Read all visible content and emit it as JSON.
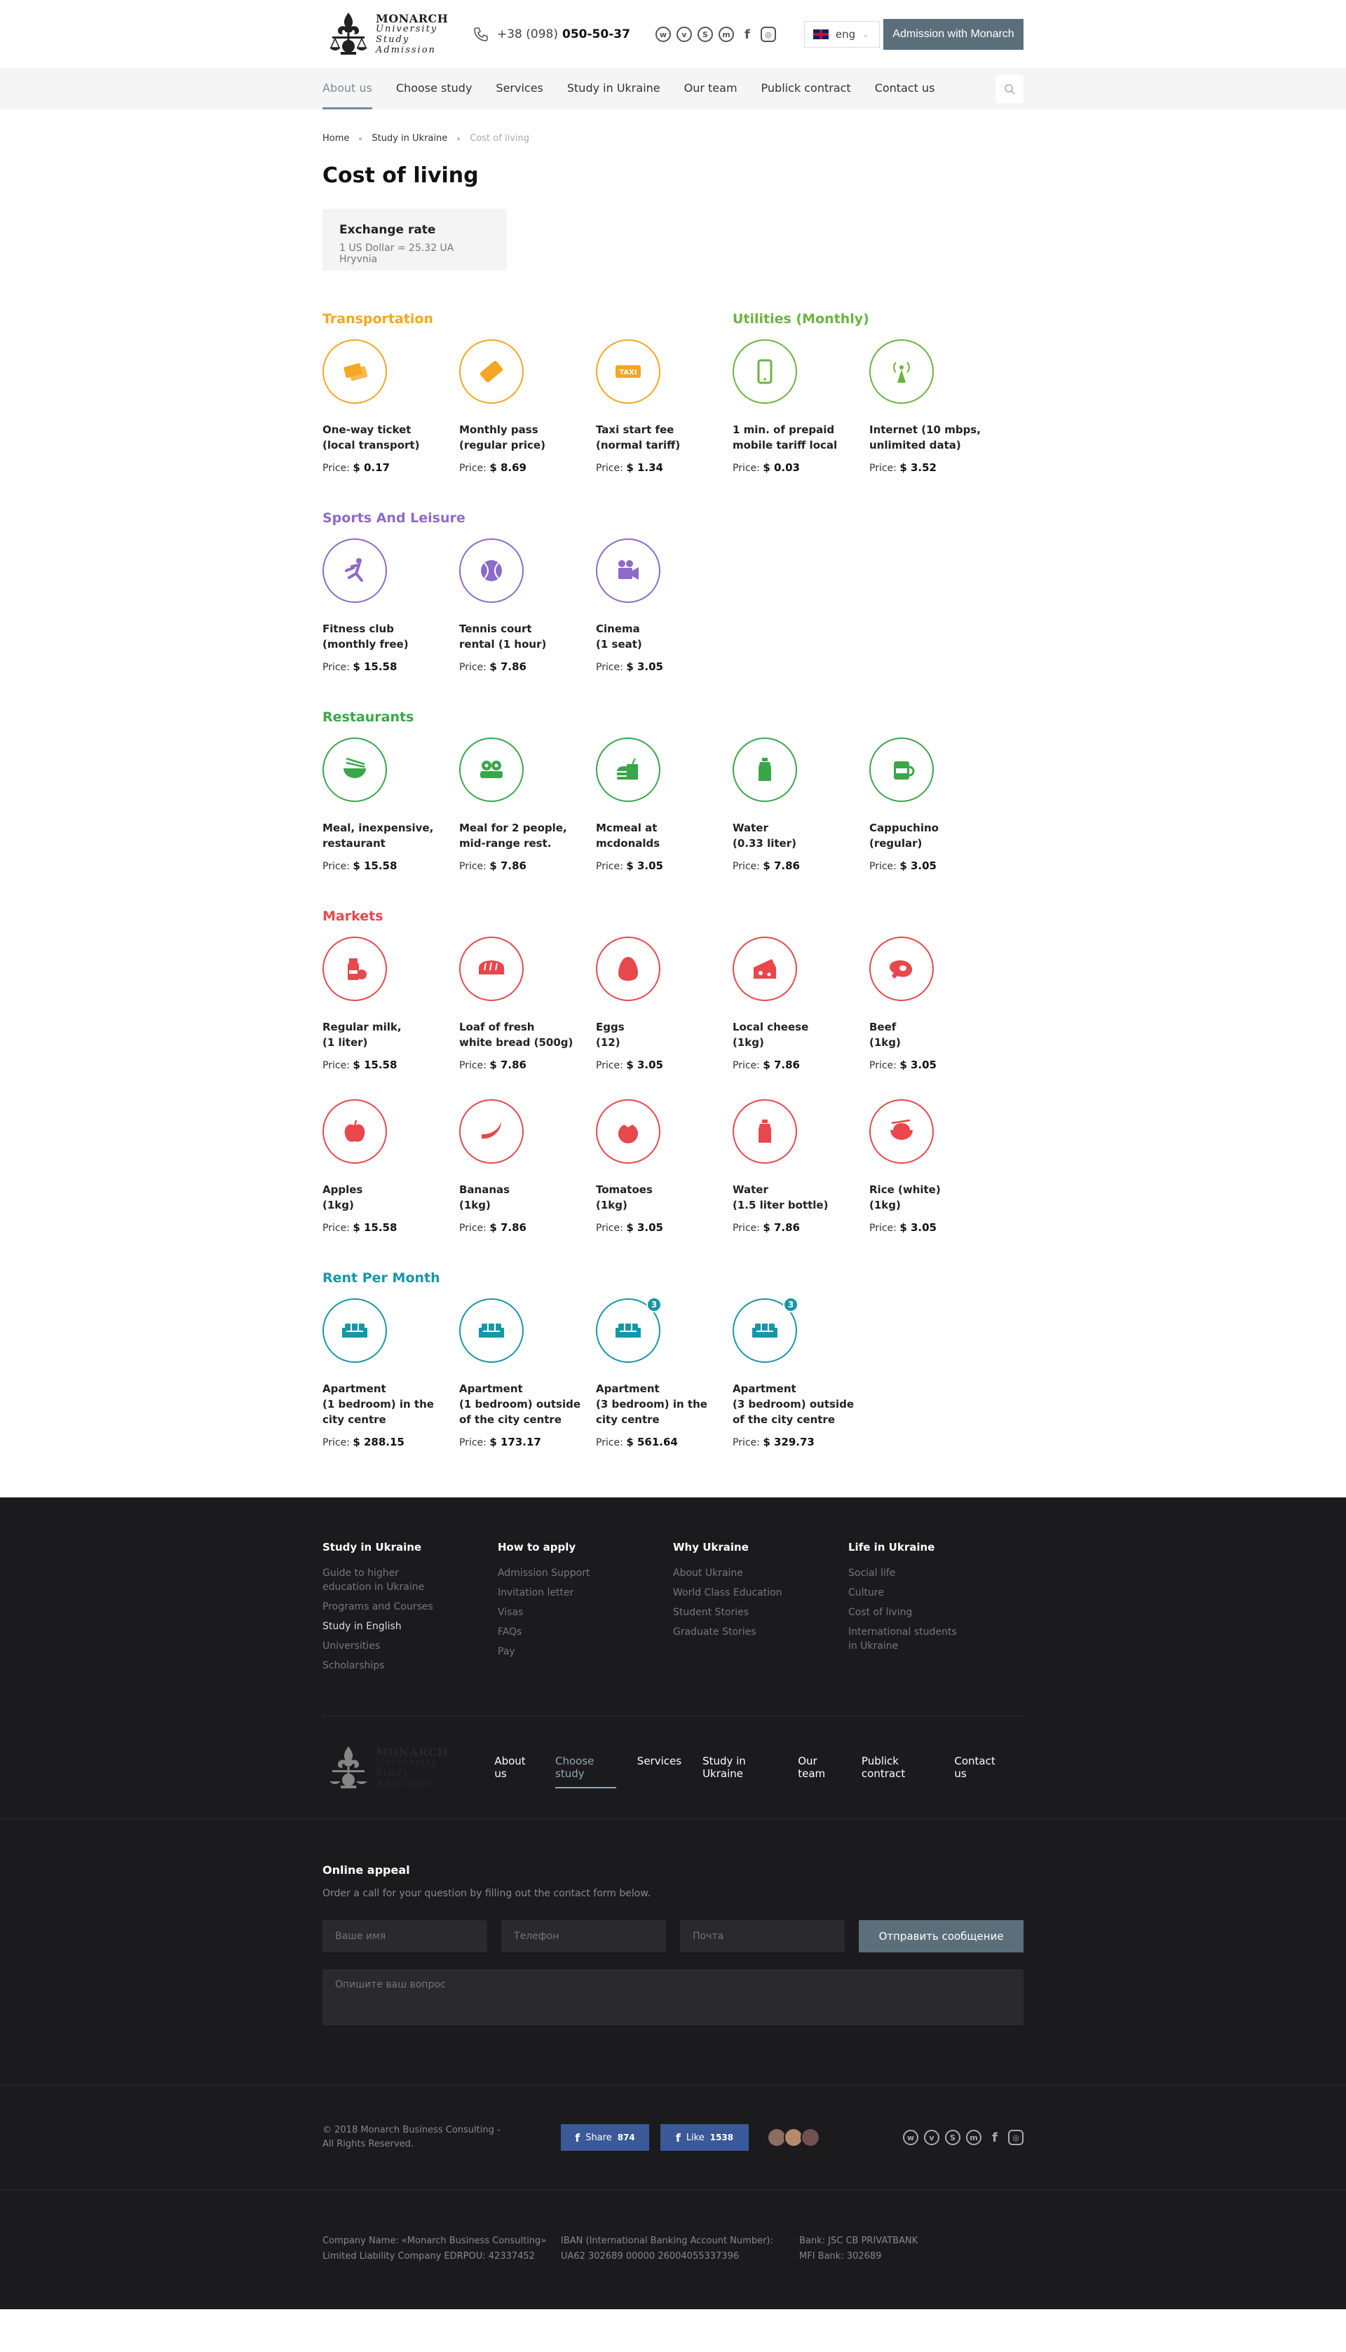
{
  "header": {
    "logo": {
      "line1": "MONARCH",
      "line2": "University",
      "line3": "Study",
      "line4": "Admission"
    },
    "phone_prefix": "+38 (098)",
    "phone_number": "050-50-37",
    "socials": [
      "whatsapp-icon",
      "viber-icon",
      "skype-icon",
      "messenger-icon",
      "facebook-icon",
      "instagram-icon"
    ],
    "lang": "eng",
    "admission_button": "Admission with Monarch"
  },
  "nav": [
    "About us",
    "Choose study",
    "Services",
    "Study in Ukraine",
    "Our team",
    "Publick contract",
    "Contact us"
  ],
  "breadcrumb": [
    "Home",
    "Study in Ukraine",
    "Cost of living"
  ],
  "page_title": "Cost of living",
  "exchange": {
    "title": "Exchange rate",
    "value": "1 US Dollar = 25.32 UA Hryvnia"
  },
  "price_label": "Price:",
  "sections": {
    "transportation": {
      "title": "Transportation",
      "color": "#f5a623",
      "items": [
        {
          "name": "One-way ticket\n(local transport)",
          "price": "$ 0.17",
          "icon": "ticket-icon"
        },
        {
          "name": "Monthly pass\n(regular price)",
          "price": "$ 8.69",
          "icon": "pass-icon"
        },
        {
          "name": "Taxi start fee\n(normal tariff)",
          "price": "$ 1.34",
          "icon": "taxi-icon",
          "badge": "TAXI"
        }
      ]
    },
    "utilities": {
      "title": "Utilities (Monthly)",
      "color": "#6cb33f",
      "items": [
        {
          "name": "1 min. of prepaid\nmobile tariff local",
          "price": "$ 0.03",
          "icon": "phone-icon"
        },
        {
          "name": "Internet (10 mbps,\nunlimited data)",
          "price": "$  3.52",
          "icon": "antenna-icon"
        }
      ]
    },
    "sports": {
      "title": "Sports And Leisure",
      "color": "#8e6ac8",
      "items": [
        {
          "name": "Fitness club\n(monthly free)",
          "price": "$ 15.58",
          "icon": "runner-icon"
        },
        {
          "name": "Tennis court\nrental (1 hour)",
          "price": "$ 7.86",
          "icon": "tennis-ball-icon"
        },
        {
          "name": "Cinema\n(1 seat)",
          "price": "$ 3.05",
          "icon": "camera-icon"
        }
      ]
    },
    "restaurants": {
      "title": "Restaurants",
      "color": "#3aa64a",
      "items": [
        {
          "name": "Meal, inexpensive,\nrestaurant",
          "price": "$ 15.58",
          "icon": "bowl-icon"
        },
        {
          "name": "Meal for 2 people,\nmid-range rest.",
          "price": "$ 7.86",
          "icon": "sushi-icon"
        },
        {
          "name": "Mcmeal at\nmcdonalds",
          "price": "$ 3.05",
          "icon": "burger-icon"
        },
        {
          "name": "Water\n(0.33 liter)",
          "price": "$ 7.86",
          "icon": "bottle-icon"
        },
        {
          "name": "Cappuchino\n(regular)",
          "price": "$ 3.05",
          "icon": "coffee-icon"
        }
      ]
    },
    "markets": {
      "title": "Markets",
      "color": "#e8474c",
      "rows": [
        [
          {
            "name": "Regular milk,\n(1 liter)",
            "price": "$ 15.58",
            "icon": "milk-icon"
          },
          {
            "name": "Loaf of fresh\nwhite bread (500g)",
            "price": "$ 7.86",
            "icon": "bread-icon"
          },
          {
            "name": "Eggs\n(12)",
            "price": "$ 3.05",
            "icon": "egg-icon"
          },
          {
            "name": "Local cheese\n(1kg)",
            "price": "$ 7.86",
            "icon": "cheese-icon"
          },
          {
            "name": "Beef\n(1kg)",
            "price": "$ 3.05",
            "icon": "beef-icon"
          }
        ],
        [
          {
            "name": "Apples\n(1kg)",
            "price": "$ 15.58",
            "icon": "apple-icon"
          },
          {
            "name": "Bananas\n(1kg)",
            "price": "$ 7.86",
            "icon": "banana-icon"
          },
          {
            "name": "Tomatoes\n(1kg)",
            "price": "$ 3.05",
            "icon": "tomato-icon"
          },
          {
            "name": "Water\n(1.5 liter bottle)",
            "price": "$ 7.86",
            "icon": "bottle-icon"
          },
          {
            "name": "Rice (white)\n(1kg)",
            "price": "$ 3.05",
            "icon": "rice-icon"
          }
        ]
      ]
    },
    "rent": {
      "title": "Rent Per Month",
      "color": "#1597a6",
      "items": [
        {
          "name": "Apartment\n(1 bedroom) in the\ncity centre",
          "price": "$ 288.15",
          "icon": "sofa-icon"
        },
        {
          "name": "Apartment\n(1 bedroom) outside\nof the city centre",
          "price": "$ 173.17",
          "icon": "sofa-icon"
        },
        {
          "name": "Apartment\n(3 bedroom) in the\ncity centre",
          "price": "$ 561.64",
          "icon": "sofa-icon",
          "num": "3"
        },
        {
          "name": "Apartment\n(3 bedroom) outside\nof the city centre",
          "price": "$ 329.73",
          "icon": "sofa-icon",
          "num": "3"
        }
      ]
    }
  },
  "footer": {
    "columns": [
      {
        "title": "Study in Ukraine",
        "links": [
          "Guide to higher\neducation in Ukraine",
          "Programs and Courses",
          "Study in English",
          "Universities",
          "Scholarships"
        ]
      },
      {
        "title": "How to apply",
        "links": [
          "Admission Support",
          "Invitation letter",
          "Visas",
          "FAQs",
          "Pay"
        ]
      },
      {
        "title": "Why Ukraine",
        "links": [
          "About Ukraine",
          "World Class Education",
          "Student Stories",
          "Graduate Stories"
        ]
      },
      {
        "title": "Life in Ukraine",
        "links": [
          "Social life",
          "Culture",
          "Cost of living",
          "International students\nin Ukraine"
        ]
      }
    ],
    "nav": [
      "About us",
      "Choose study",
      "Services",
      "Study in Ukraine",
      "Our team",
      "Publick contract",
      "Contact us"
    ],
    "appeal": {
      "title": "Online appeal",
      "text": "Order a call for your question by filling out the contact form below.",
      "name_placeholder": "Ваше имя",
      "phone_placeholder": "Телефон",
      "email_placeholder": "Почта",
      "send": "Отправить сообщение",
      "question_placeholder": "Опишите ваш вопрос"
    },
    "copyright": "© 2018 Monarch Business Consulting -\nAll Rights Reserved.",
    "share": {
      "label": "Share",
      "count": "874"
    },
    "like": {
      "label": "Like",
      "count": "1538"
    },
    "legal": [
      "Company Name: «Monarch Business Consulting»\nLimited Liability Company EDRPOU: 42337452",
      "IBAN (International Banking Account Number):\nUA62 302689 00000 26004055337396",
      "Bank: JSC CB PRIVATBANK\nMFI Bank: 302689"
    ]
  }
}
